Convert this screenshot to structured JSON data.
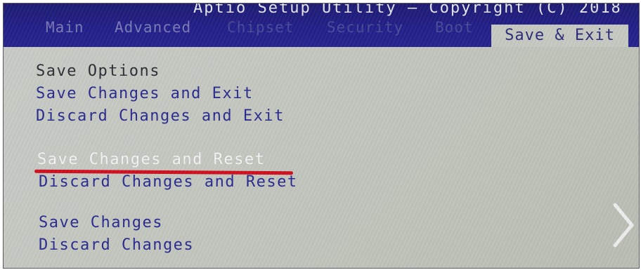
{
  "header": {
    "title": "Aptio Setup Utility – Copyright (C) 2018",
    "tabs": [
      {
        "label": "Main"
      },
      {
        "label": "Advanced"
      },
      {
        "label": "Chipset"
      },
      {
        "label": "Security"
      },
      {
        "label": "Boot"
      },
      {
        "label": "Save & Exit"
      }
    ],
    "active_tab": "Save & Exit"
  },
  "menu": {
    "section_title": "Save Options",
    "items": [
      {
        "label": "Save Changes and Exit"
      },
      {
        "label": "Discard Changes and Exit"
      },
      {
        "label": "Save Changes and Reset",
        "selected": true
      },
      {
        "label": "Discard Changes and Reset"
      },
      {
        "label": "Save Changes"
      },
      {
        "label": "Discard Changes"
      }
    ]
  },
  "annotation": {
    "underline_color": "#d10f1f",
    "underlined_item": "Save Changes and Reset"
  },
  "colors": {
    "header_bg": "#23208a",
    "body_bg": "#c4c7c0",
    "option_text": "#2a2b8f",
    "selected_text": "#f4f4f4"
  },
  "icons": {
    "overlay": "chevron-right-icon"
  }
}
